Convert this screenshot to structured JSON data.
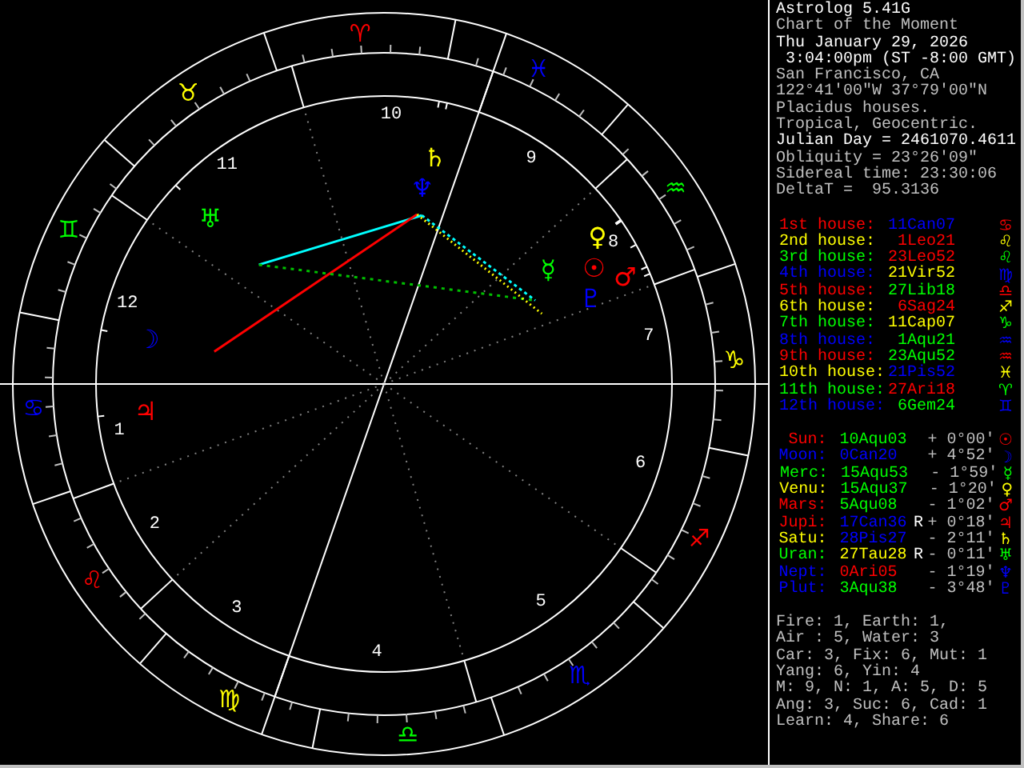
{
  "header": [
    {
      "text": "Astrolog 5.41G",
      "highlighted": true
    },
    {
      "text": "Chart of the Moment",
      "highlighted": false
    },
    {
      "text": "Thu January 29, 2026",
      "highlighted": true
    },
    {
      "text": " 3:04:00pm (ST -8:00 GMT)",
      "highlighted": true
    },
    {
      "text": "San Francisco, CA",
      "highlighted": false
    },
    {
      "text": "122°41'00\"W 37°79'00\"N",
      "highlighted": false
    },
    {
      "text": "Placidus houses.",
      "highlighted": false
    },
    {
      "text": "Tropical, Geocentric.",
      "highlighted": false
    },
    {
      "text": "Julian Day = 2461070.4611",
      "highlighted": true
    },
    {
      "text": "Obliquity = 23°26'09\"",
      "highlighted": false
    },
    {
      "text": "Sidereal time: 23:30:06",
      "highlighted": false
    },
    {
      "text": "DeltaT =  95.3136",
      "highlighted": false
    }
  ],
  "houses": [
    {
      "label": "1st house:",
      "color": "#ff0000",
      "position": {
        "text": "11Can07",
        "color": "#0000ff"
      },
      "glyph": "♋"
    },
    {
      "label": "2nd house:",
      "color": "#ffff00",
      "position": {
        "text": "1Leo21",
        "color": "#ff0000"
      },
      "glyph": "♌"
    },
    {
      "label": "3rd house:",
      "color": "#00ff00",
      "position": {
        "text": "23Leo52",
        "color": "#ff0000"
      },
      "glyph": "♌"
    },
    {
      "label": "4th house:",
      "color": "#0000ff",
      "position": {
        "text": "21Vir52",
        "color": "#ffff00"
      },
      "glyph": "♍"
    },
    {
      "label": "5th house:",
      "color": "#ff0000",
      "position": {
        "text": "27Lib18",
        "color": "#00ff00"
      },
      "glyph": "♎"
    },
    {
      "label": "6th house:",
      "color": "#ffff00",
      "position": {
        "text": "6Sag24",
        "color": "#ff0000"
      },
      "glyph": "♐"
    },
    {
      "label": "7th house:",
      "color": "#00ff00",
      "position": {
        "text": "11Cap07",
        "color": "#ffff00"
      },
      "glyph": "♑"
    },
    {
      "label": "8th house:",
      "color": "#0000ff",
      "position": {
        "text": "1Aqu21",
        "color": "#00ff00"
      },
      "glyph": "♒"
    },
    {
      "label": "9th house:",
      "color": "#ff0000",
      "position": {
        "text": "23Aqu52",
        "color": "#00ff00"
      },
      "glyph": "♒"
    },
    {
      "label": "10th house:",
      "color": "#ffff00",
      "position": {
        "text": "21Pis52",
        "color": "#0000ff"
      },
      "glyph": "♓"
    },
    {
      "label": "11th house:",
      "color": "#00ff00",
      "position": {
        "text": "27Ari18",
        "color": "#ff0000"
      },
      "glyph": "♈"
    },
    {
      "label": "12th house:",
      "color": "#0000ff",
      "position": {
        "text": "6Gem24",
        "color": "#00ff00"
      },
      "glyph": "♊"
    }
  ],
  "planets": [
    {
      "label": "Sun:",
      "color": "#ff0000",
      "position": {
        "text": "10Aqu03",
        "color": "#00ff00"
      },
      "latitude": "+ 0°00′",
      "glyph": "☉"
    },
    {
      "label": "Moon:",
      "color": "#0000ff",
      "position": {
        "text": "0Can20",
        "color": "#0000ff"
      },
      "latitude": "+ 4°52′",
      "glyph": "☽"
    },
    {
      "label": "Merc:",
      "color": "#00ff00",
      "position": {
        "text": "15Aqu53",
        "color": "#00ff00"
      },
      "latitude": "- 1°59′",
      "glyph": "☿"
    },
    {
      "label": "Venu:",
      "color": "#ffff00",
      "position": {
        "text": "15Aqu37",
        "color": "#00ff00"
      },
      "latitude": "- 1°20′",
      "glyph": "♀"
    },
    {
      "label": "Mars:",
      "color": "#ff0000",
      "position": {
        "text": "5Aqu08",
        "color": "#00ff00"
      },
      "latitude": "- 1°02′",
      "glyph": "♂"
    },
    {
      "label": "Jupi:",
      "color": "#ff0000",
      "position": {
        "text": "17Can36",
        "color": "#0000ff"
      },
      "retro": "R",
      "latitude": "+ 0°18′",
      "glyph": "♃"
    },
    {
      "label": "Satu:",
      "color": "#ffff00",
      "position": {
        "text": "28Pis27",
        "color": "#0000ff"
      },
      "latitude": "- 2°11′",
      "glyph": "♄"
    },
    {
      "label": "Uran:",
      "color": "#00ff00",
      "position": {
        "text": "27Tau28",
        "color": "#ffff00"
      },
      "retro": "R",
      "latitude": "- 0°11′",
      "glyph": "♅"
    },
    {
      "label": "Nept:",
      "color": "#0000ff",
      "position": {
        "text": "0Ari05",
        "color": "#ff0000"
      },
      "latitude": "- 1°19′",
      "glyph": "♆"
    },
    {
      "label": "Plut:",
      "color": "#0000ff",
      "position": {
        "text": "3Aqu38",
        "color": "#00ff00"
      },
      "latitude": "- 3°48′",
      "glyph": "♇"
    }
  ],
  "summary": [
    "Fire: 1, Earth: 1,",
    "Air : 5, Water: 3",
    "Car: 3, Fix: 6, Mut: 1",
    "Yang: 6, Yin: 4",
    "M: 9, N: 1, A: 5, D: 5",
    "Ang: 3, Suc: 6, Cad: 1",
    "Learn: 4, Share: 6"
  ],
  "wheel": {
    "signs": [
      {
        "glyph": "♈",
        "color": "#ff0000"
      },
      {
        "glyph": "♉",
        "color": "#ffff00"
      },
      {
        "glyph": "♊",
        "color": "#00ff00"
      },
      {
        "glyph": "♋",
        "color": "#0000ff"
      },
      {
        "glyph": "♌",
        "color": "#ff0000"
      },
      {
        "glyph": "♍",
        "color": "#ffff00"
      },
      {
        "glyph": "♎",
        "color": "#00ff00"
      },
      {
        "glyph": "♏",
        "color": "#0000ff"
      },
      {
        "glyph": "♐",
        "color": "#ff0000"
      },
      {
        "glyph": "♑",
        "color": "#ffff00"
      },
      {
        "glyph": "♒",
        "color": "#00ff00"
      },
      {
        "glyph": "♓",
        "color": "#0000ff"
      }
    ],
    "house_numbers": [
      "1",
      "2",
      "3",
      "4",
      "5",
      "6",
      "7",
      "8",
      "9",
      "10",
      "11",
      "12"
    ],
    "planets": [
      {
        "glyph": "☉",
        "color": "#ff0000"
      },
      {
        "glyph": "☽",
        "color": "#0000ff"
      },
      {
        "glyph": "☿",
        "color": "#00ff00"
      },
      {
        "glyph": "♀",
        "color": "#ffff00"
      },
      {
        "glyph": "♂",
        "color": "#ff0000"
      },
      {
        "glyph": "♃",
        "color": "#ff0000"
      },
      {
        "glyph": "♄",
        "color": "#ffff00"
      },
      {
        "glyph": "♅",
        "color": "#00ff00"
      },
      {
        "glyph": "♆",
        "color": "#0000ff"
      },
      {
        "glyph": "♇",
        "color": "#0000ff"
      }
    ]
  }
}
